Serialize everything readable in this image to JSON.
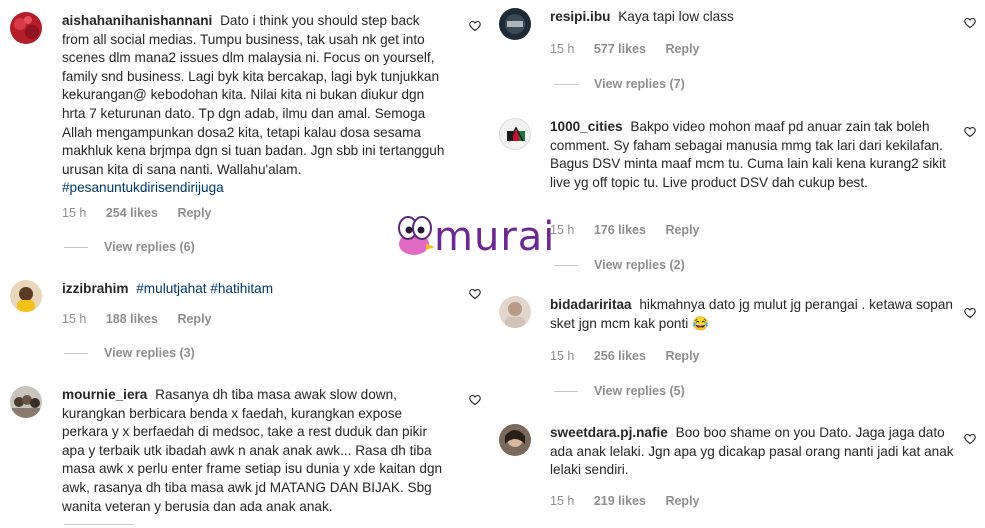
{
  "watermark": {
    "brand": "murai"
  },
  "reply_label": "Reply",
  "comments": [
    {
      "username": "aishahanihanishannani",
      "text": "Dato i think you should step back from all social medias. Tumpu business, tak usah nk get into scenes dlm mana2 issues dlm malaysia ni. Focus on yourself, family snd business. Lagi byk kita bercakap, lagi byk tunjukkan kekurangan@ kebodohan kita. Nilai kita ni bukan diukur dgn hrta 7 keturunan dato. Tp dgn adab, ilmu dan amal. Semoga Allah mengampunkan dosa2 kita, tetapi kalau dosa sesama makhluk kena brjmpa dgn si tuan badan. Jgn sbb ini tertangguh urusan kita di sana nanti. Wallahu'alam.",
      "hashtag": "#pesanuntukdirisendirijuga",
      "time": "15 h",
      "likes": "254 likes",
      "view_replies": "View replies (6)"
    },
    {
      "username": "izzibrahim",
      "text": "",
      "hashtag": "#mulutjahat #hatihitam",
      "time": "15 h",
      "likes": "188 likes",
      "view_replies": "View replies (3)"
    },
    {
      "username": "mournie_iera",
      "text": "Rasanya dh tiba masa awak slow down, kurangkan berbicara benda x faedah, kurangkan expose perkara y x berfaedah di medsoc, take a rest duduk dan pikir apa y terbaik utk ibadah awk n anak anak awk... Rasa dh tiba masa awk x perlu enter frame setiap isu dunia y xde kaitan dgn awk, rasanya dh tiba masa awk jd MATANG DAN BIJAK. Sbg wanita veteran y berusia dan ada anak anak.",
      "hashtag": ""
    },
    {
      "username": "resipi.ibu",
      "text": "Kaya tapi low class",
      "hashtag": "",
      "time": "15 h",
      "likes": "577 likes",
      "view_replies": "View replies (7)"
    },
    {
      "username": "1000_cities",
      "text": "Bakpo video mohon maaf pd anuar zain tak boleh comment. Sy faham sebagai manusia mmg tak lari dari kekilafan. Bagus DSV minta maaf mcm tu. Cuma lain kali kena kurang2 sikit live yg off topic tu. Live product DSV dah cukup best.",
      "hashtag": "",
      "time": "15 h",
      "likes": "176 likes",
      "view_replies": "View replies (2)"
    },
    {
      "username": "bidadariritaa",
      "text": "hikmahnya dato jg mulut jg perangai . ketawa sopan sket jgn mcm kak ponti 😂",
      "hashtag": "",
      "time": "15 h",
      "likes": "256 likes",
      "view_replies": "View replies (5)"
    },
    {
      "username": "sweetdara.pj.nafie",
      "text": "Boo boo shame on you Dato. Jaga jaga dato ada anak lelaki. Jgn apa yg dicakap pasal orang nanti jadi kat anak lelaki sendiri.",
      "hashtag": "",
      "time": "15 h",
      "likes": "219 likes"
    }
  ],
  "colors": {
    "text": "#262626",
    "meta": "#8e8e8e",
    "hashtag": "#00376b",
    "brand": "#6b2a90"
  },
  "icons": [
    "heart-icon",
    "murai-bird-logo"
  ]
}
